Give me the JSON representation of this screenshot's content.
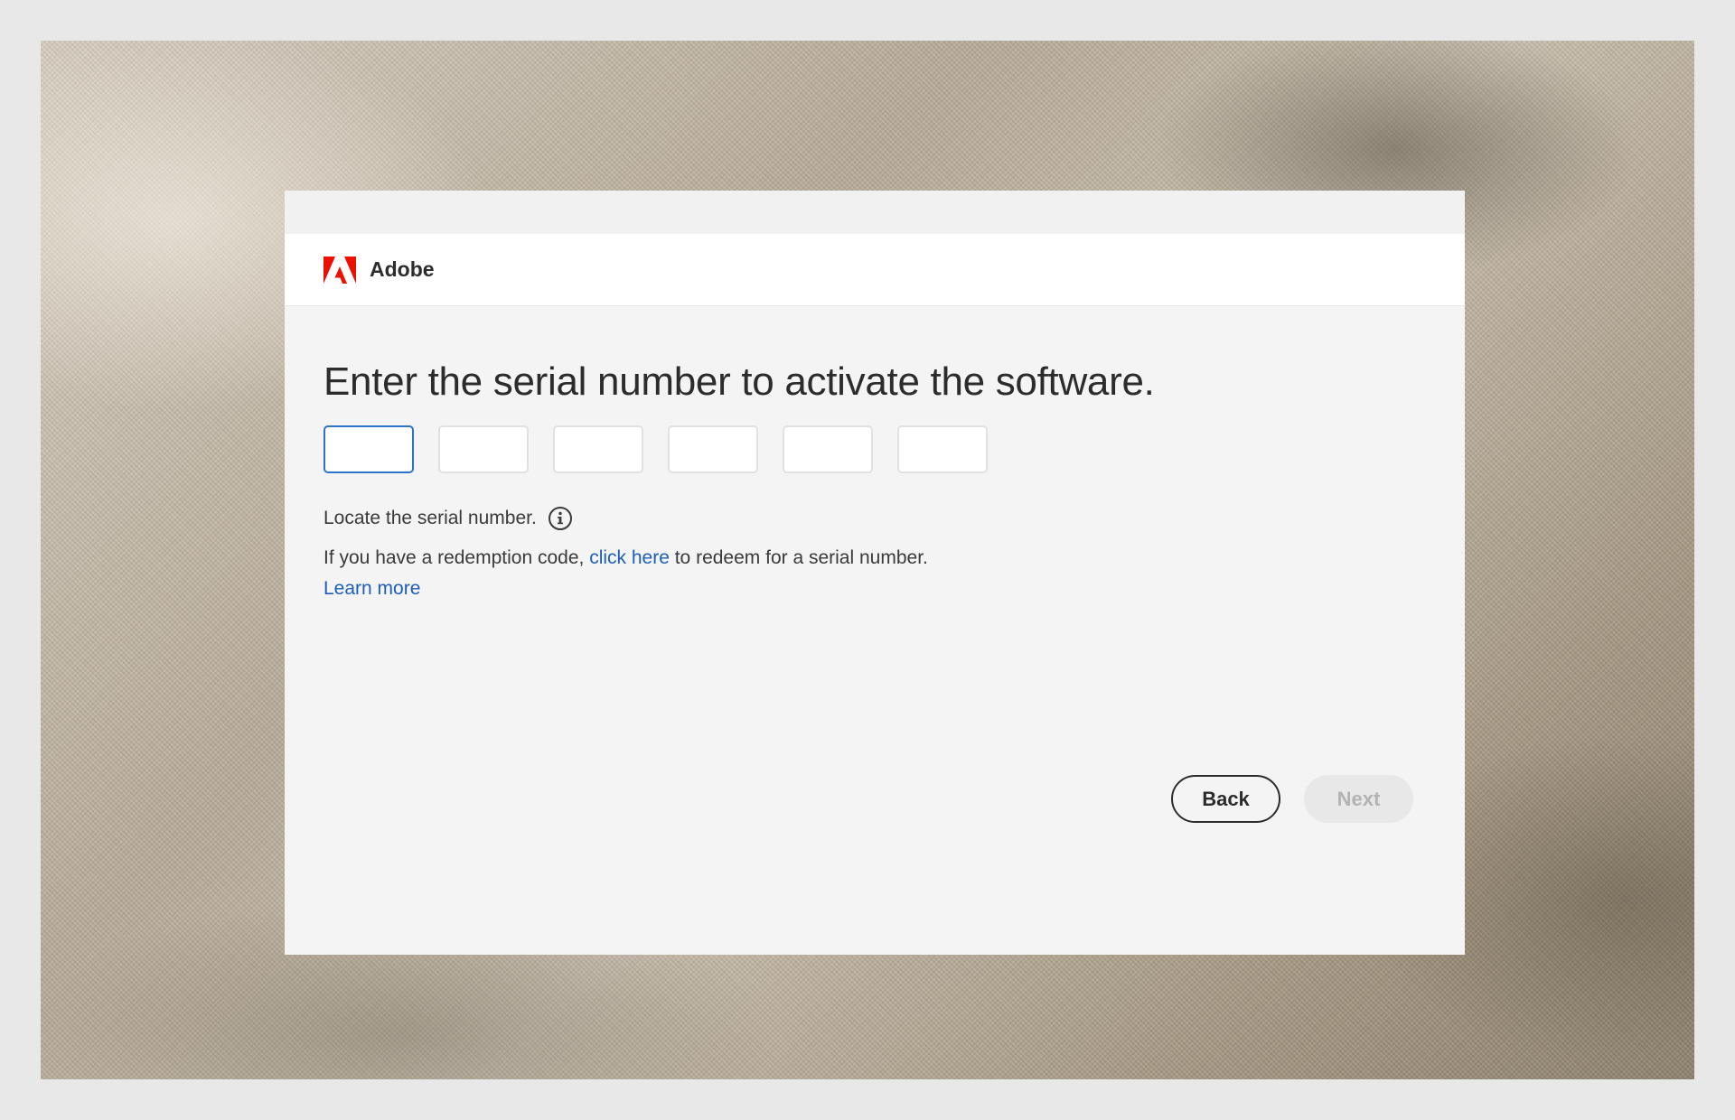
{
  "colors": {
    "accent": "#2c74c7",
    "link": "#1d5fb8",
    "adobe_red": "#eb1000",
    "text": "#2c2c2c",
    "disabled": "#b3b3b3"
  },
  "header": {
    "brand": "Adobe",
    "logo_icon": "adobe-logo-icon"
  },
  "main": {
    "title": "Enter the serial number to activate the software.",
    "serial_fields": [
      {
        "value": "",
        "focused": true
      },
      {
        "value": "",
        "focused": false
      },
      {
        "value": "",
        "focused": false
      },
      {
        "value": "",
        "focused": false
      },
      {
        "value": "",
        "focused": false
      },
      {
        "value": "",
        "focused": false
      }
    ],
    "locate_text": "Locate the serial number.",
    "info_icon": "info-icon",
    "redeem_prefix": "If you have a redemption code, ",
    "redeem_link": "click here",
    "redeem_suffix": " to redeem for a serial number.",
    "learn_more": "Learn more"
  },
  "footer": {
    "back_label": "Back",
    "next_label": "Next",
    "next_enabled": false
  }
}
